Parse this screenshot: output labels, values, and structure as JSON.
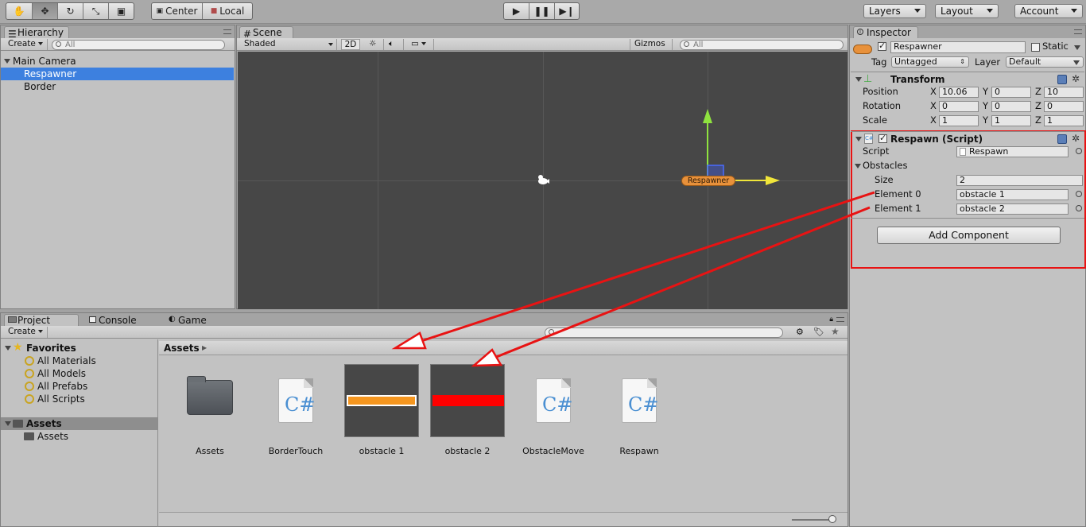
{
  "toolbar": {
    "pivot_label": "Center",
    "space_label": "Local",
    "layers_label": "Layers",
    "layout_label": "Layout",
    "account_label": "Account"
  },
  "hierarchy": {
    "tab_label": "Hierarchy",
    "create_label": "Create",
    "search_placeholder": "All",
    "items": [
      {
        "label": "Main Camera",
        "selected": false
      },
      {
        "label": "Respawner",
        "selected": true
      },
      {
        "label": "Border",
        "selected": false
      }
    ]
  },
  "scene": {
    "tab_label": "Scene",
    "shading_mode": "Shaded",
    "mode_2d_label": "2D",
    "gizmos_label": "Gizmos",
    "search_placeholder": "All",
    "object_label": "Respawner"
  },
  "inspector": {
    "tab_label": "Inspector",
    "object_name": "Respawner",
    "static_label": "Static",
    "tag_label": "Tag",
    "tag_value": "Untagged",
    "layer_label": "Layer",
    "layer_value": "Default",
    "transform": {
      "title": "Transform",
      "position_label": "Position",
      "rotation_label": "Rotation",
      "scale_label": "Scale",
      "axis_x": "X",
      "axis_y": "Y",
      "axis_z": "Z",
      "position": [
        "10.06",
        "0",
        "10"
      ],
      "rotation": [
        "0",
        "0",
        "0"
      ],
      "scale": [
        "1",
        "1",
        "1"
      ]
    },
    "respawn": {
      "title": "Respawn (Script)",
      "script_label": "Script",
      "script_value": "Respawn",
      "obstacles_label": "Obstacles",
      "size_label": "Size",
      "size_value": "2",
      "element0_label": "Element 0",
      "element0_value": "obstacle 1",
      "element1_label": "Element 1",
      "element1_value": "obstacle 2"
    },
    "add_component_label": "Add Component"
  },
  "project": {
    "tabs": [
      "Project",
      "Console",
      "Game"
    ],
    "create_label": "Create",
    "favorites_label": "Favorites",
    "favorites": [
      "All Materials",
      "All Models",
      "All Prefabs",
      "All Scripts"
    ],
    "assets_root_label": "Assets",
    "assets_child_label": "Assets",
    "breadcrumb": "Assets",
    "assets": [
      {
        "name": "Assets",
        "type": "folder"
      },
      {
        "name": "BorderTouch",
        "type": "script"
      },
      {
        "name": "obstacle 1",
        "type": "prefab",
        "color": "#f5961f"
      },
      {
        "name": "obstacle 2",
        "type": "prefab",
        "color": "#ff0000"
      },
      {
        "name": "ObstacleMove",
        "type": "script"
      },
      {
        "name": "Respawn",
        "type": "script"
      }
    ]
  },
  "annotation_color": "#e81313"
}
